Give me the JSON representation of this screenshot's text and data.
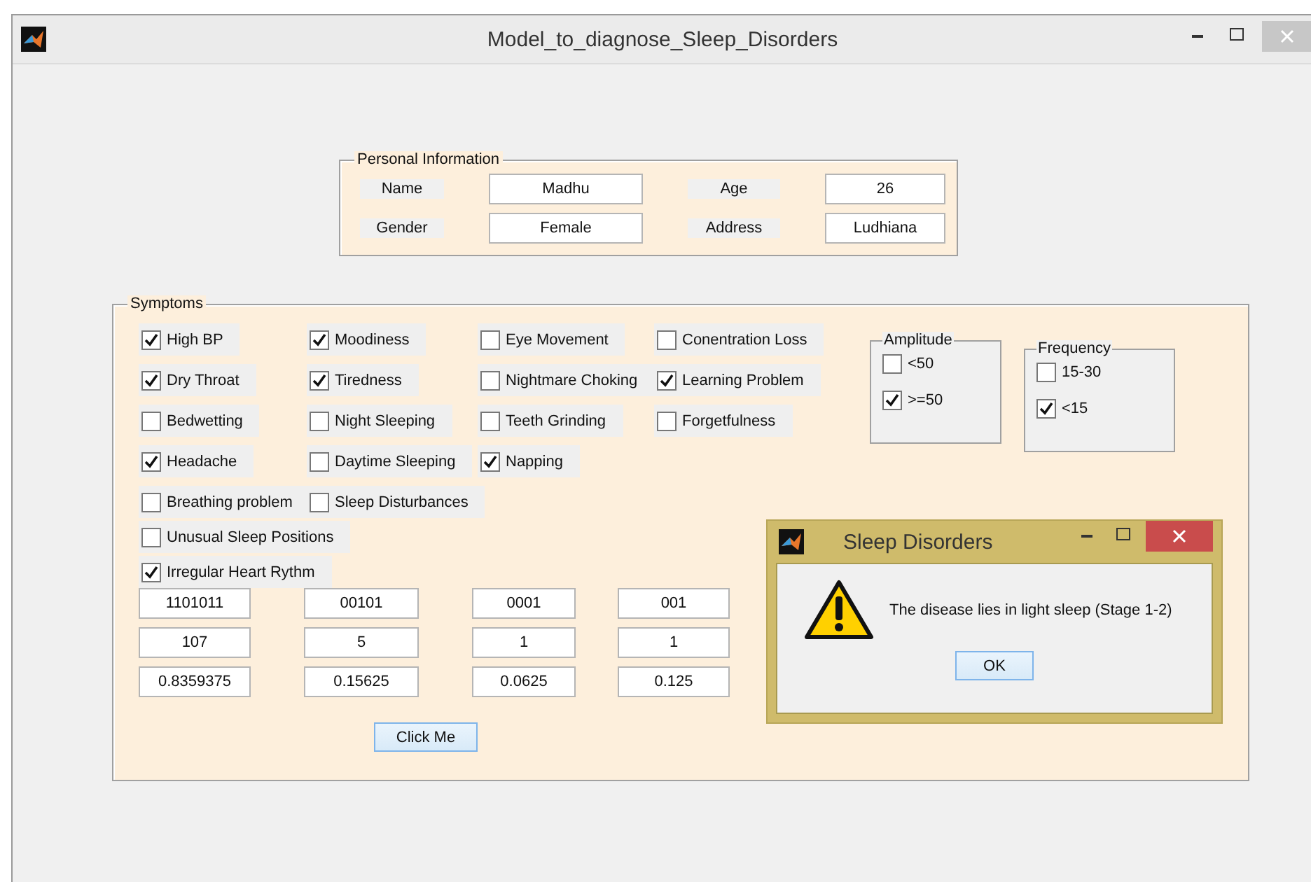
{
  "window": {
    "title": "Model_to_diagnose_Sleep_Disorders"
  },
  "personal_information": {
    "title": "Personal Information",
    "fields": [
      {
        "label": "Name",
        "value": "Madhu"
      },
      {
        "label": "Age",
        "value": "26"
      },
      {
        "label": "Gender",
        "value": "Female"
      },
      {
        "label": "Address",
        "value": "Ludhiana"
      }
    ]
  },
  "symptoms": {
    "title": "Symptoms",
    "rows": [
      [
        {
          "label": "High BP",
          "checked": true
        },
        {
          "label": "Moodiness",
          "checked": true
        },
        {
          "label": "Eye Movement",
          "checked": false
        },
        {
          "label": "Conentration Loss",
          "checked": false
        }
      ],
      [
        {
          "label": "Dry Throat",
          "checked": true
        },
        {
          "label": "Tiredness",
          "checked": true
        },
        {
          "label": "Nightmare Choking",
          "checked": false
        },
        {
          "label": "Learning Problem",
          "checked": true
        }
      ],
      [
        {
          "label": "Bedwetting",
          "checked": false
        },
        {
          "label": "Night Sleeping",
          "checked": false
        },
        {
          "label": "Teeth Grinding",
          "checked": false
        },
        {
          "label": "Forgetfulness",
          "checked": false
        }
      ],
      [
        {
          "label": "Headache",
          "checked": true
        },
        {
          "label": "Daytime Sleeping",
          "checked": false
        },
        {
          "label": "Napping",
          "checked": true
        }
      ],
      [
        {
          "label": "Breathing problem",
          "checked": false
        },
        {
          "label": "Sleep Disturbances",
          "checked": false
        }
      ],
      [
        {
          "label": "Unusual Sleep Positions",
          "checked": false
        }
      ],
      [
        {
          "label": "Irregular Heart Rythm",
          "checked": true
        }
      ]
    ],
    "groups": [
      {
        "title": "Amplitude",
        "options": [
          {
            "label": "<50",
            "checked": false
          },
          {
            "label": ">=50",
            "checked": true
          }
        ]
      },
      {
        "title": "Frequency",
        "options": [
          {
            "label": "15-30",
            "checked": false
          },
          {
            "label": "<15",
            "checked": true
          }
        ]
      }
    ],
    "outputs": [
      [
        "1101011",
        "00101",
        "0001",
        "001"
      ],
      [
        "107",
        "5",
        "1",
        "1"
      ],
      [
        "0.8359375",
        "0.15625",
        "0.0625",
        "0.125"
      ]
    ],
    "button": "Click Me"
  },
  "dialog": {
    "title": "Sleep Disorders",
    "message": "The disease lies in light sleep (Stage 1-2)",
    "button": "OK"
  }
}
